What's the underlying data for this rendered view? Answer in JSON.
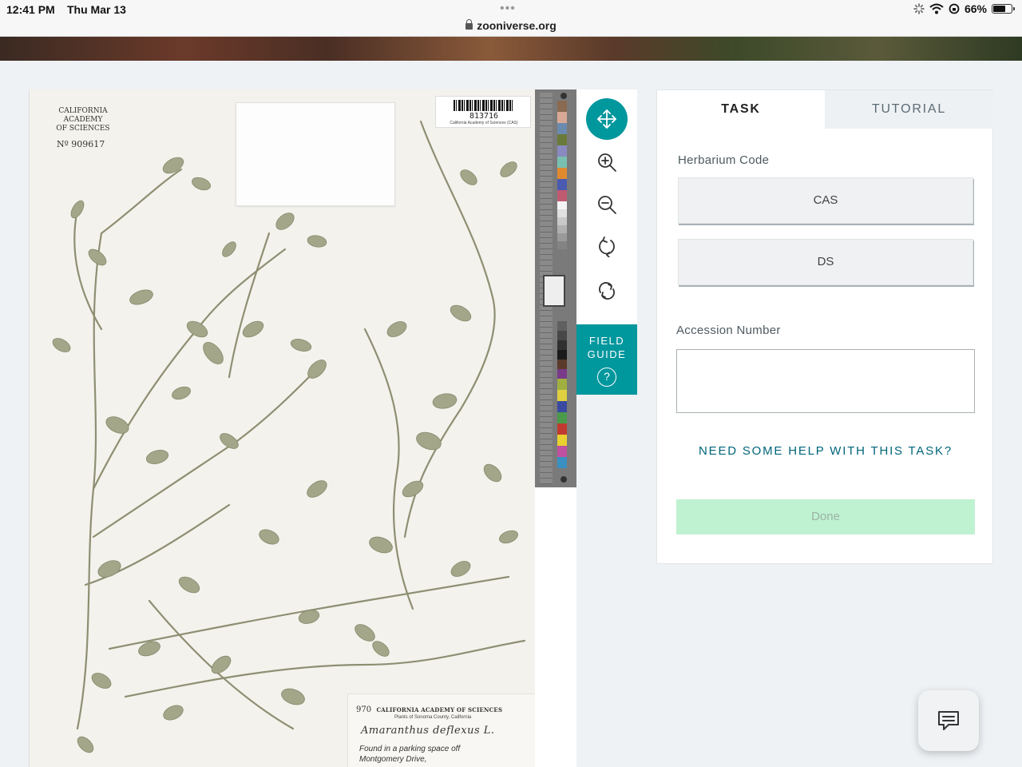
{
  "status_bar": {
    "time": "12:41 PM",
    "date": "Thu Mar 13",
    "url": "zooniverse.org",
    "battery": "66%",
    "battery_level": 0.66,
    "icons": [
      "activity-spinner-icon",
      "wifi-icon",
      "screen-lock-icon",
      "battery-icon"
    ]
  },
  "specimen": {
    "institution_line1": "CALIFORNIA ACADEMY",
    "institution_line2": "OF SCIENCES",
    "sheet_number": "Nº 909617",
    "barcode_number": "813716",
    "barcode_caption": "California Academy of Sciences (CAS)",
    "label_number": "970",
    "label_institution": "CALIFORNIA ACADEMY OF SCIENCES",
    "label_locale": "Plants of Sonoma County, California",
    "species": "Amaranthus deflexus L.",
    "note_line1": "Found in a parking space off",
    "note_line2": "Montgomery Drive,"
  },
  "toolbar": {
    "tools": [
      "move-icon",
      "zoom-in-icon",
      "zoom-out-icon",
      "rotate-icon",
      "reset-icon"
    ],
    "field_guide_line1": "FIELD",
    "field_guide_line2": "GUIDE",
    "field_guide_icon": "?"
  },
  "panel": {
    "tabs": [
      {
        "label": "TASK",
        "active": true
      },
      {
        "label": "TUTORIAL",
        "active": false
      }
    ],
    "herbarium_label": "Herbarium Code",
    "choices": [
      "CAS",
      "DS"
    ],
    "accession_label": "Accession Number",
    "accession_value": "",
    "help_link": "NEED SOME HELP WITH THIS TASK?",
    "done_label": "Done"
  },
  "colors": {
    "accent": "#00979d",
    "done_bg": "#bff2d1",
    "link": "#00657a"
  }
}
